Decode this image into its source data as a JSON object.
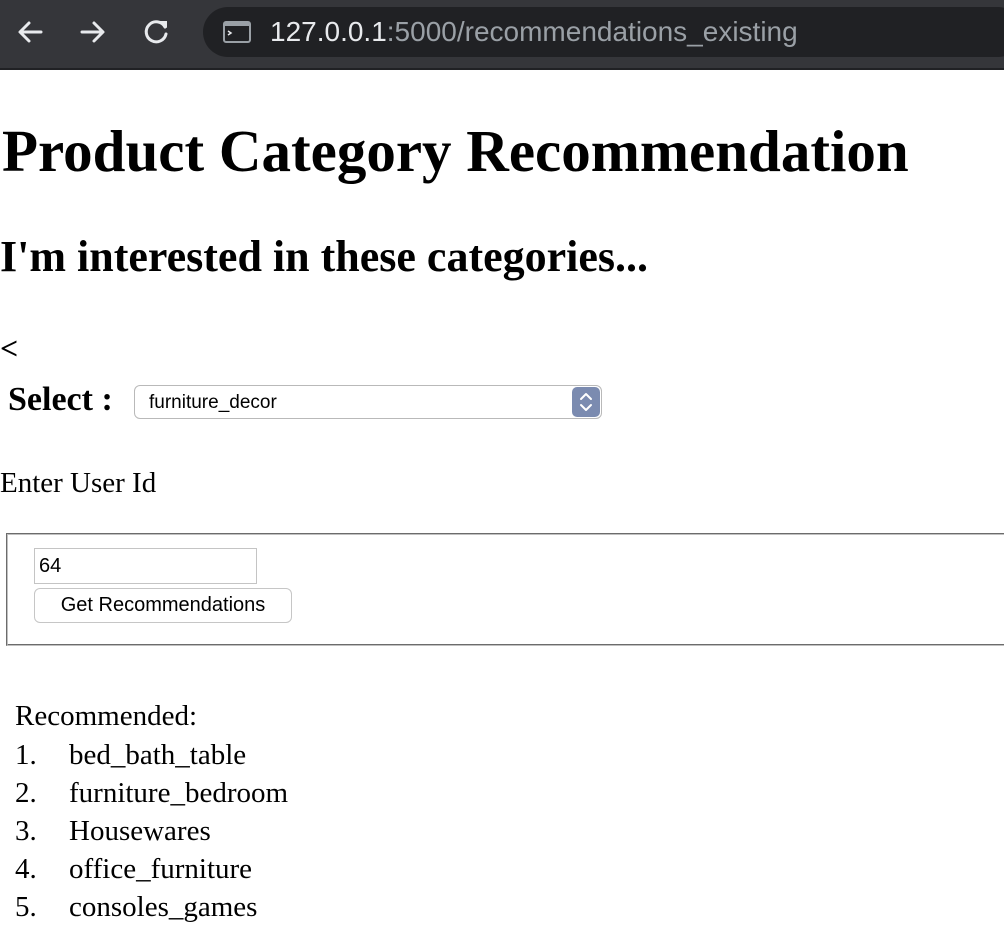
{
  "browser": {
    "url_host": "127.0.0.1",
    "url_rest": ":5000/recommendations_existing",
    "icons": [
      "back-arrow-icon",
      "forward-arrow-icon",
      "reload-icon",
      "terminal-page-icon"
    ]
  },
  "page": {
    "title": "Product Category Recommendation",
    "subtitle": "I'm interested in these categories...",
    "stray_char": "<",
    "select_label": "Select :",
    "selected_category": "furniture_decor",
    "user_id_label": "Enter User Id",
    "user_id_value": "64",
    "button_label": "Get Recommendations",
    "recommended_label": "Recommended:",
    "recommendations": [
      {
        "num": "1.",
        "name": "bed_bath_table"
      },
      {
        "num": "2.",
        "name": "furniture_bedroom"
      },
      {
        "num": "3.",
        "name": "Housewares"
      },
      {
        "num": "4.",
        "name": "office_furniture"
      },
      {
        "num": "5.",
        "name": "consoles_games"
      }
    ]
  },
  "colors": {
    "chrome_bg": "#35363a",
    "omnibox_bg": "#202124",
    "url_host": "#e8eaed",
    "url_rest": "#9aa0a6",
    "select_arrow_bg": "#7b8bb0"
  }
}
